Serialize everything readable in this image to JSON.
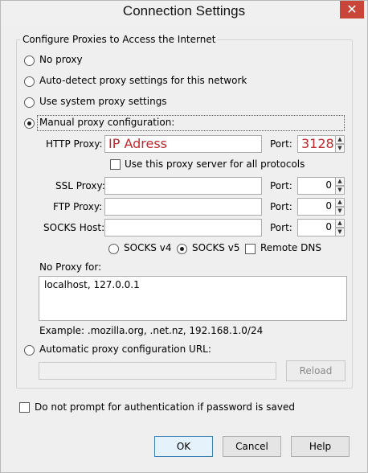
{
  "window": {
    "title": "Connection Settings",
    "close_glyph": "✕"
  },
  "group": {
    "label": "Configure Proxies to Access the Internet"
  },
  "options": {
    "no_proxy": "No proxy",
    "auto_detect": "Auto-detect proxy settings for this network",
    "system": "Use system proxy settings",
    "manual": "Manual proxy configuration:",
    "auto_url": "Automatic proxy configuration URL:",
    "selected": "manual"
  },
  "manual": {
    "http_label": "HTTP Proxy:",
    "http_value": "IP Adress",
    "http_port_label": "Port:",
    "http_port": "3128",
    "use_all_label": "Use this proxy server for all protocols",
    "ssl_label": "SSL Proxy:",
    "ssl_value": "",
    "ssl_port_label": "Port:",
    "ssl_port": "0",
    "ftp_label": "FTP Proxy:",
    "ftp_value": "",
    "ftp_port_label": "Port:",
    "ftp_port": "0",
    "socks_label": "SOCKS Host:",
    "socks_value": "",
    "socks_port_label": "Port:",
    "socks_port": "0",
    "socks_v4": "SOCKS v4",
    "socks_v5": "SOCKS v5",
    "socks_selected": "v5",
    "remote_dns": "Remote DNS"
  },
  "no_proxy": {
    "label": "No Proxy for:",
    "value": "localhost, 127.0.0.1",
    "example": "Example: .mozilla.org, .net.nz, 192.168.1.0/24"
  },
  "auto_url": {
    "value": "",
    "reload": "Reload"
  },
  "auth_prompt": {
    "label": "Do not prompt for authentication if password is saved"
  },
  "buttons": {
    "ok": "OK",
    "cancel": "Cancel",
    "help": "Help"
  },
  "spin": {
    "up": "▲",
    "down": "▼"
  }
}
